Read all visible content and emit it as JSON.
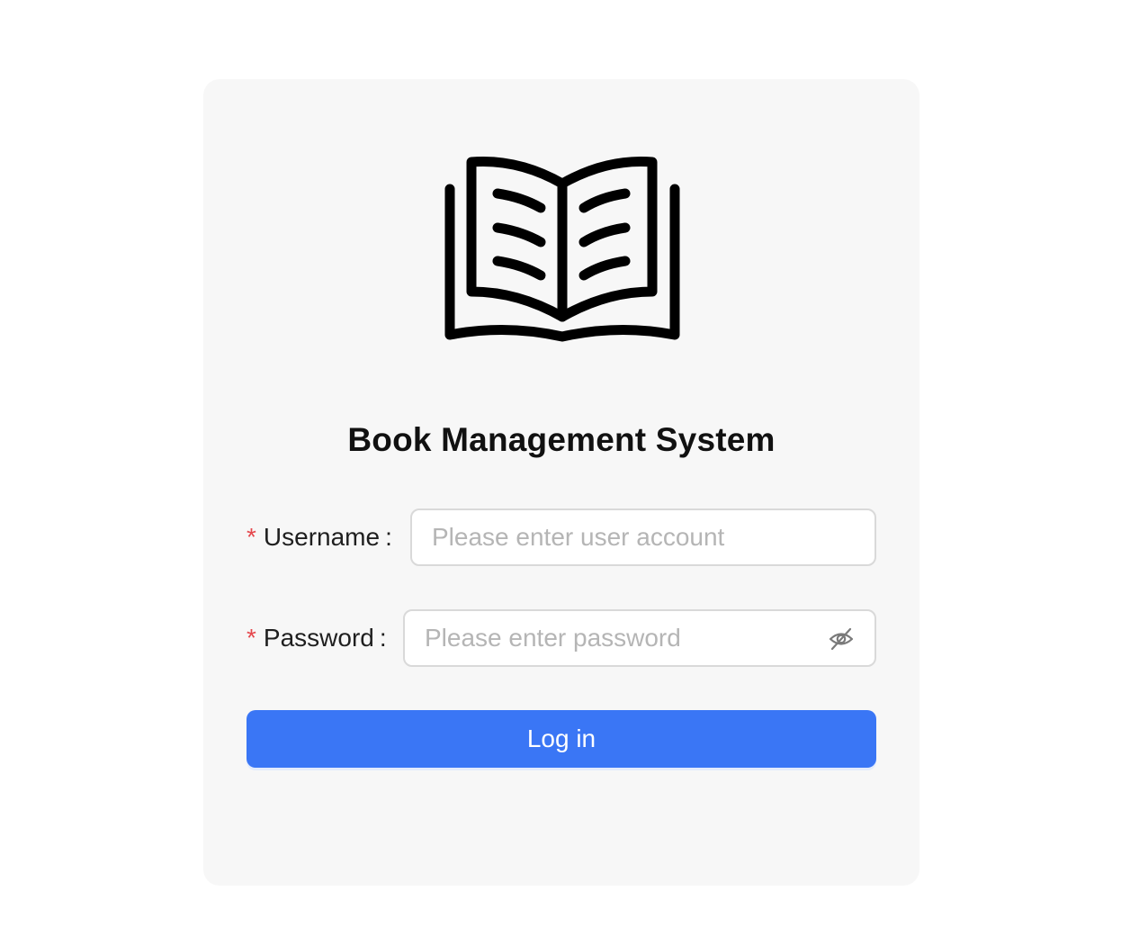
{
  "app": {
    "title": "Book Management System",
    "logo_icon": "open-book-icon"
  },
  "form": {
    "username": {
      "required_mark": "*",
      "label": "Username",
      "colon": ":",
      "placeholder": "Please enter user account",
      "value": ""
    },
    "password": {
      "required_mark": "*",
      "label": "Password",
      "colon": ":",
      "placeholder": "Please enter password",
      "value": "",
      "toggle_icon": "eye-off-icon"
    },
    "submit_label": "Log in"
  },
  "colors": {
    "primary": "#3a76f5",
    "required": "#e5484d",
    "card_background": "#f7f7f7"
  }
}
